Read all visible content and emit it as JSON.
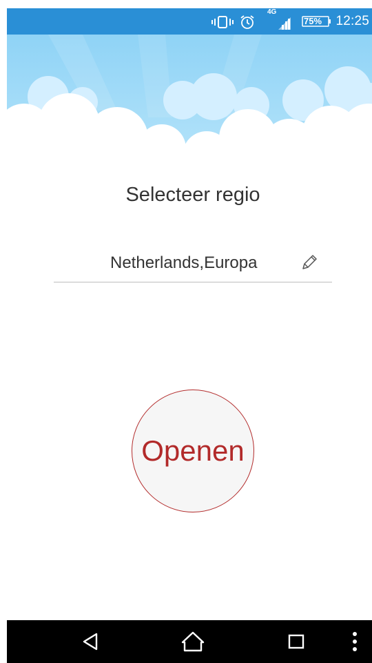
{
  "status_bar": {
    "time": "12:25",
    "battery_label": "75%",
    "network_type": "4G",
    "icons": [
      "vibrate-icon",
      "alarm-icon",
      "signal-icon",
      "battery-icon"
    ],
    "background_color": "#2a8fd6"
  },
  "header": {
    "background_icon": "sky-clouds-illustration"
  },
  "main": {
    "title": "Selecteer regio",
    "region_value": "Netherlands,Europa",
    "edit_icon": "pencil-icon",
    "open_button_label": "Openen",
    "accent_color": "#b22a2a"
  },
  "nav_bar": {
    "buttons": [
      "back-icon",
      "home-icon",
      "recents-icon",
      "more-icon"
    ]
  }
}
